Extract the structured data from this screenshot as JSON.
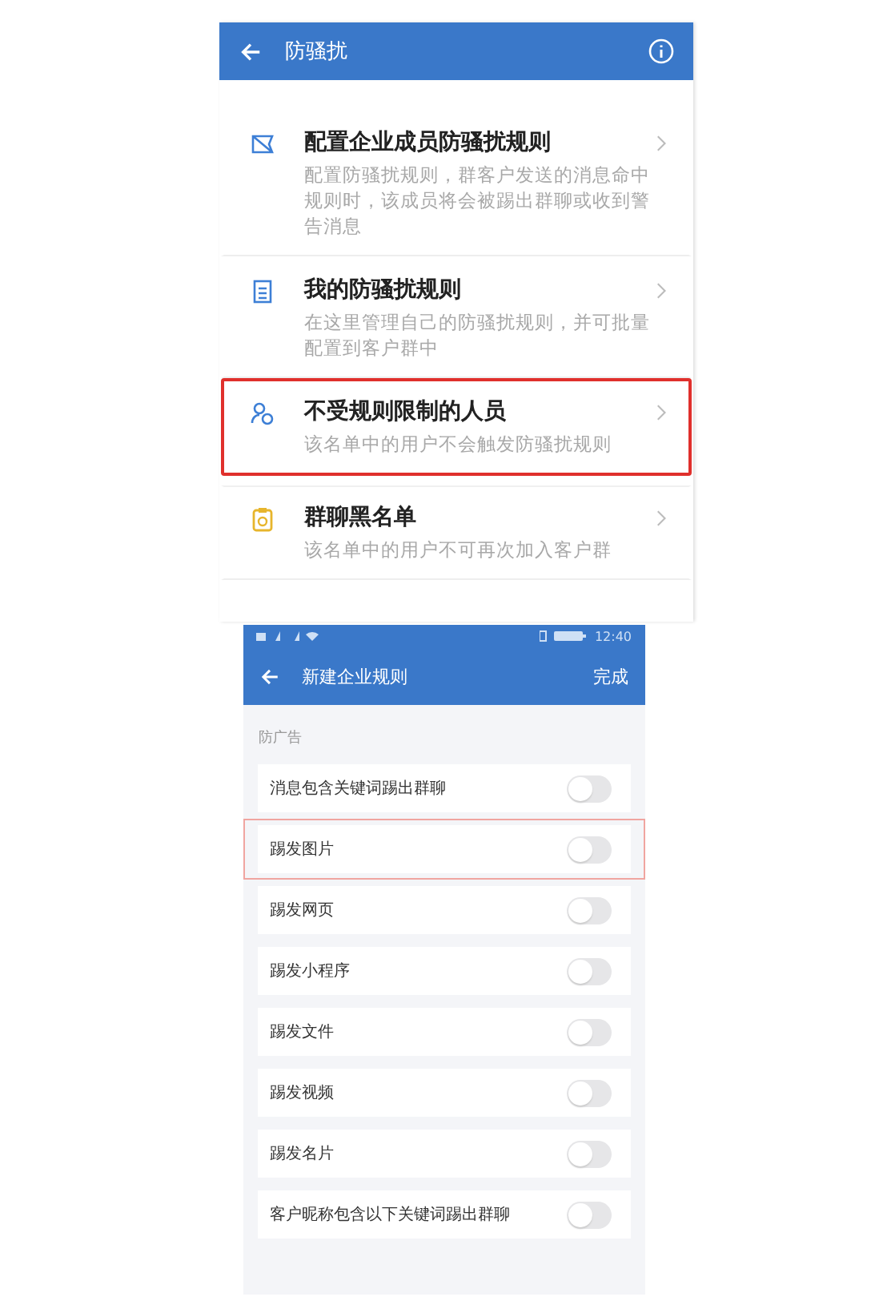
{
  "top_screen": {
    "title": "防骚扰",
    "items": [
      {
        "title": "配置企业成员防骚扰规则",
        "description": "配置防骚扰规则，群客户发送的消息命中规则时，该成员将会被踢出群聊或收到警告消息",
        "highlighted": false
      },
      {
        "title": "我的防骚扰规则",
        "description": "在这里管理自己的防骚扰规则，并可批量配置到客户群中",
        "highlighted": false
      },
      {
        "title": "不受规则限制的人员",
        "description": "该名单中的用户不会触发防骚扰规则",
        "highlighted": true
      },
      {
        "title": "群聊黑名单",
        "description": "该名单中的用户不可再次加入客户群",
        "highlighted": false
      }
    ]
  },
  "bottom_screen": {
    "status_bar": {
      "time": "12:40"
    },
    "title": "新建企业规则",
    "done": "完成",
    "section": "防广告",
    "rules": [
      {
        "label": "消息包含关键词踢出群聊",
        "on": false,
        "highlighted": false
      },
      {
        "label": "踢发图片",
        "on": false,
        "highlighted": true
      },
      {
        "label": "踢发网页",
        "on": false,
        "highlighted": false
      },
      {
        "label": "踢发小程序",
        "on": false,
        "highlighted": false
      },
      {
        "label": "踢发文件",
        "on": false,
        "highlighted": false
      },
      {
        "label": "踢发视频",
        "on": false,
        "highlighted": false
      },
      {
        "label": "踢发名片",
        "on": false,
        "highlighted": false
      },
      {
        "label": "客户昵称包含以下关键词踢出群聊",
        "on": false,
        "highlighted": false
      }
    ]
  }
}
